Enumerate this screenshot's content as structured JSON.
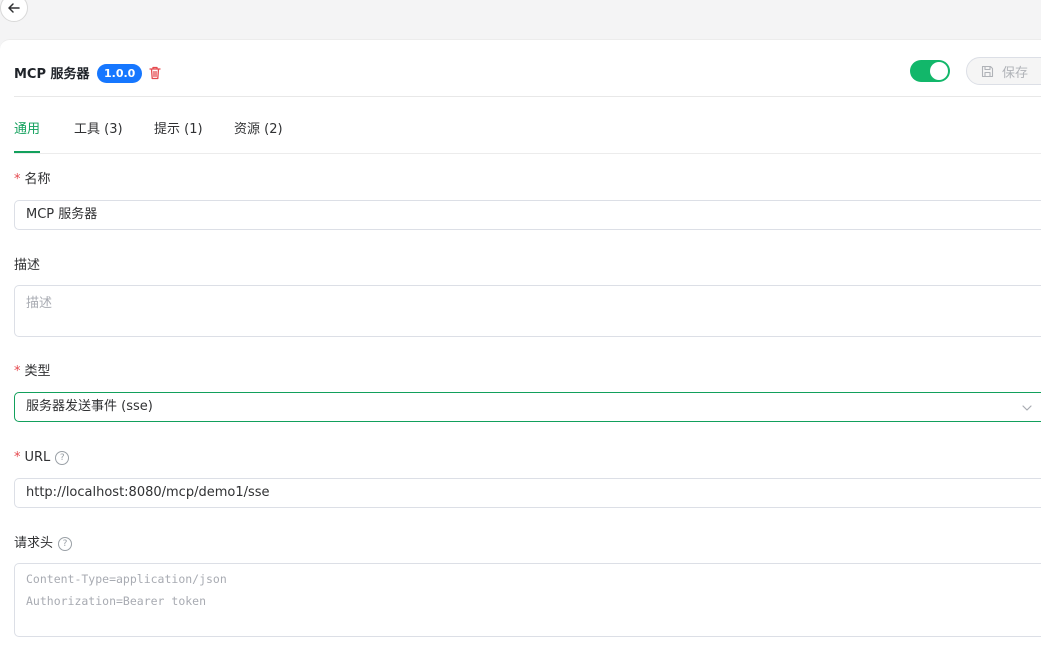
{
  "header": {
    "title": "MCP 服务器",
    "version": "1.0.0",
    "enabled": true,
    "save_label": "保存"
  },
  "tabs": [
    {
      "label": "通用",
      "active": true
    },
    {
      "label": "工具 (3)",
      "active": false
    },
    {
      "label": "提示 (1)",
      "active": false
    },
    {
      "label": "资源 (2)",
      "active": false
    }
  ],
  "form": {
    "name": {
      "required_mark": "*",
      "label": "名称",
      "value": "MCP 服务器"
    },
    "description": {
      "label": "描述",
      "placeholder": "描述"
    },
    "type": {
      "required_mark": "*",
      "label": "类型",
      "value": "服务器发送事件 (sse)"
    },
    "url": {
      "required_mark": "*",
      "label": "URL",
      "value": "http://localhost:8080/mcp/demo1/sse"
    },
    "headers": {
      "label": "请求头",
      "placeholder_lines": [
        "Content-Type=application/json",
        "Authorization=Bearer token"
      ]
    }
  },
  "colors": {
    "accent": "#12a05c",
    "version_badge": "#1677ff",
    "required": "#e5484d",
    "delete": "#e5484d"
  },
  "icons": [
    "back-arrow-icon",
    "trash-icon",
    "save-icon",
    "help-icon",
    "chevron-down-icon"
  ]
}
